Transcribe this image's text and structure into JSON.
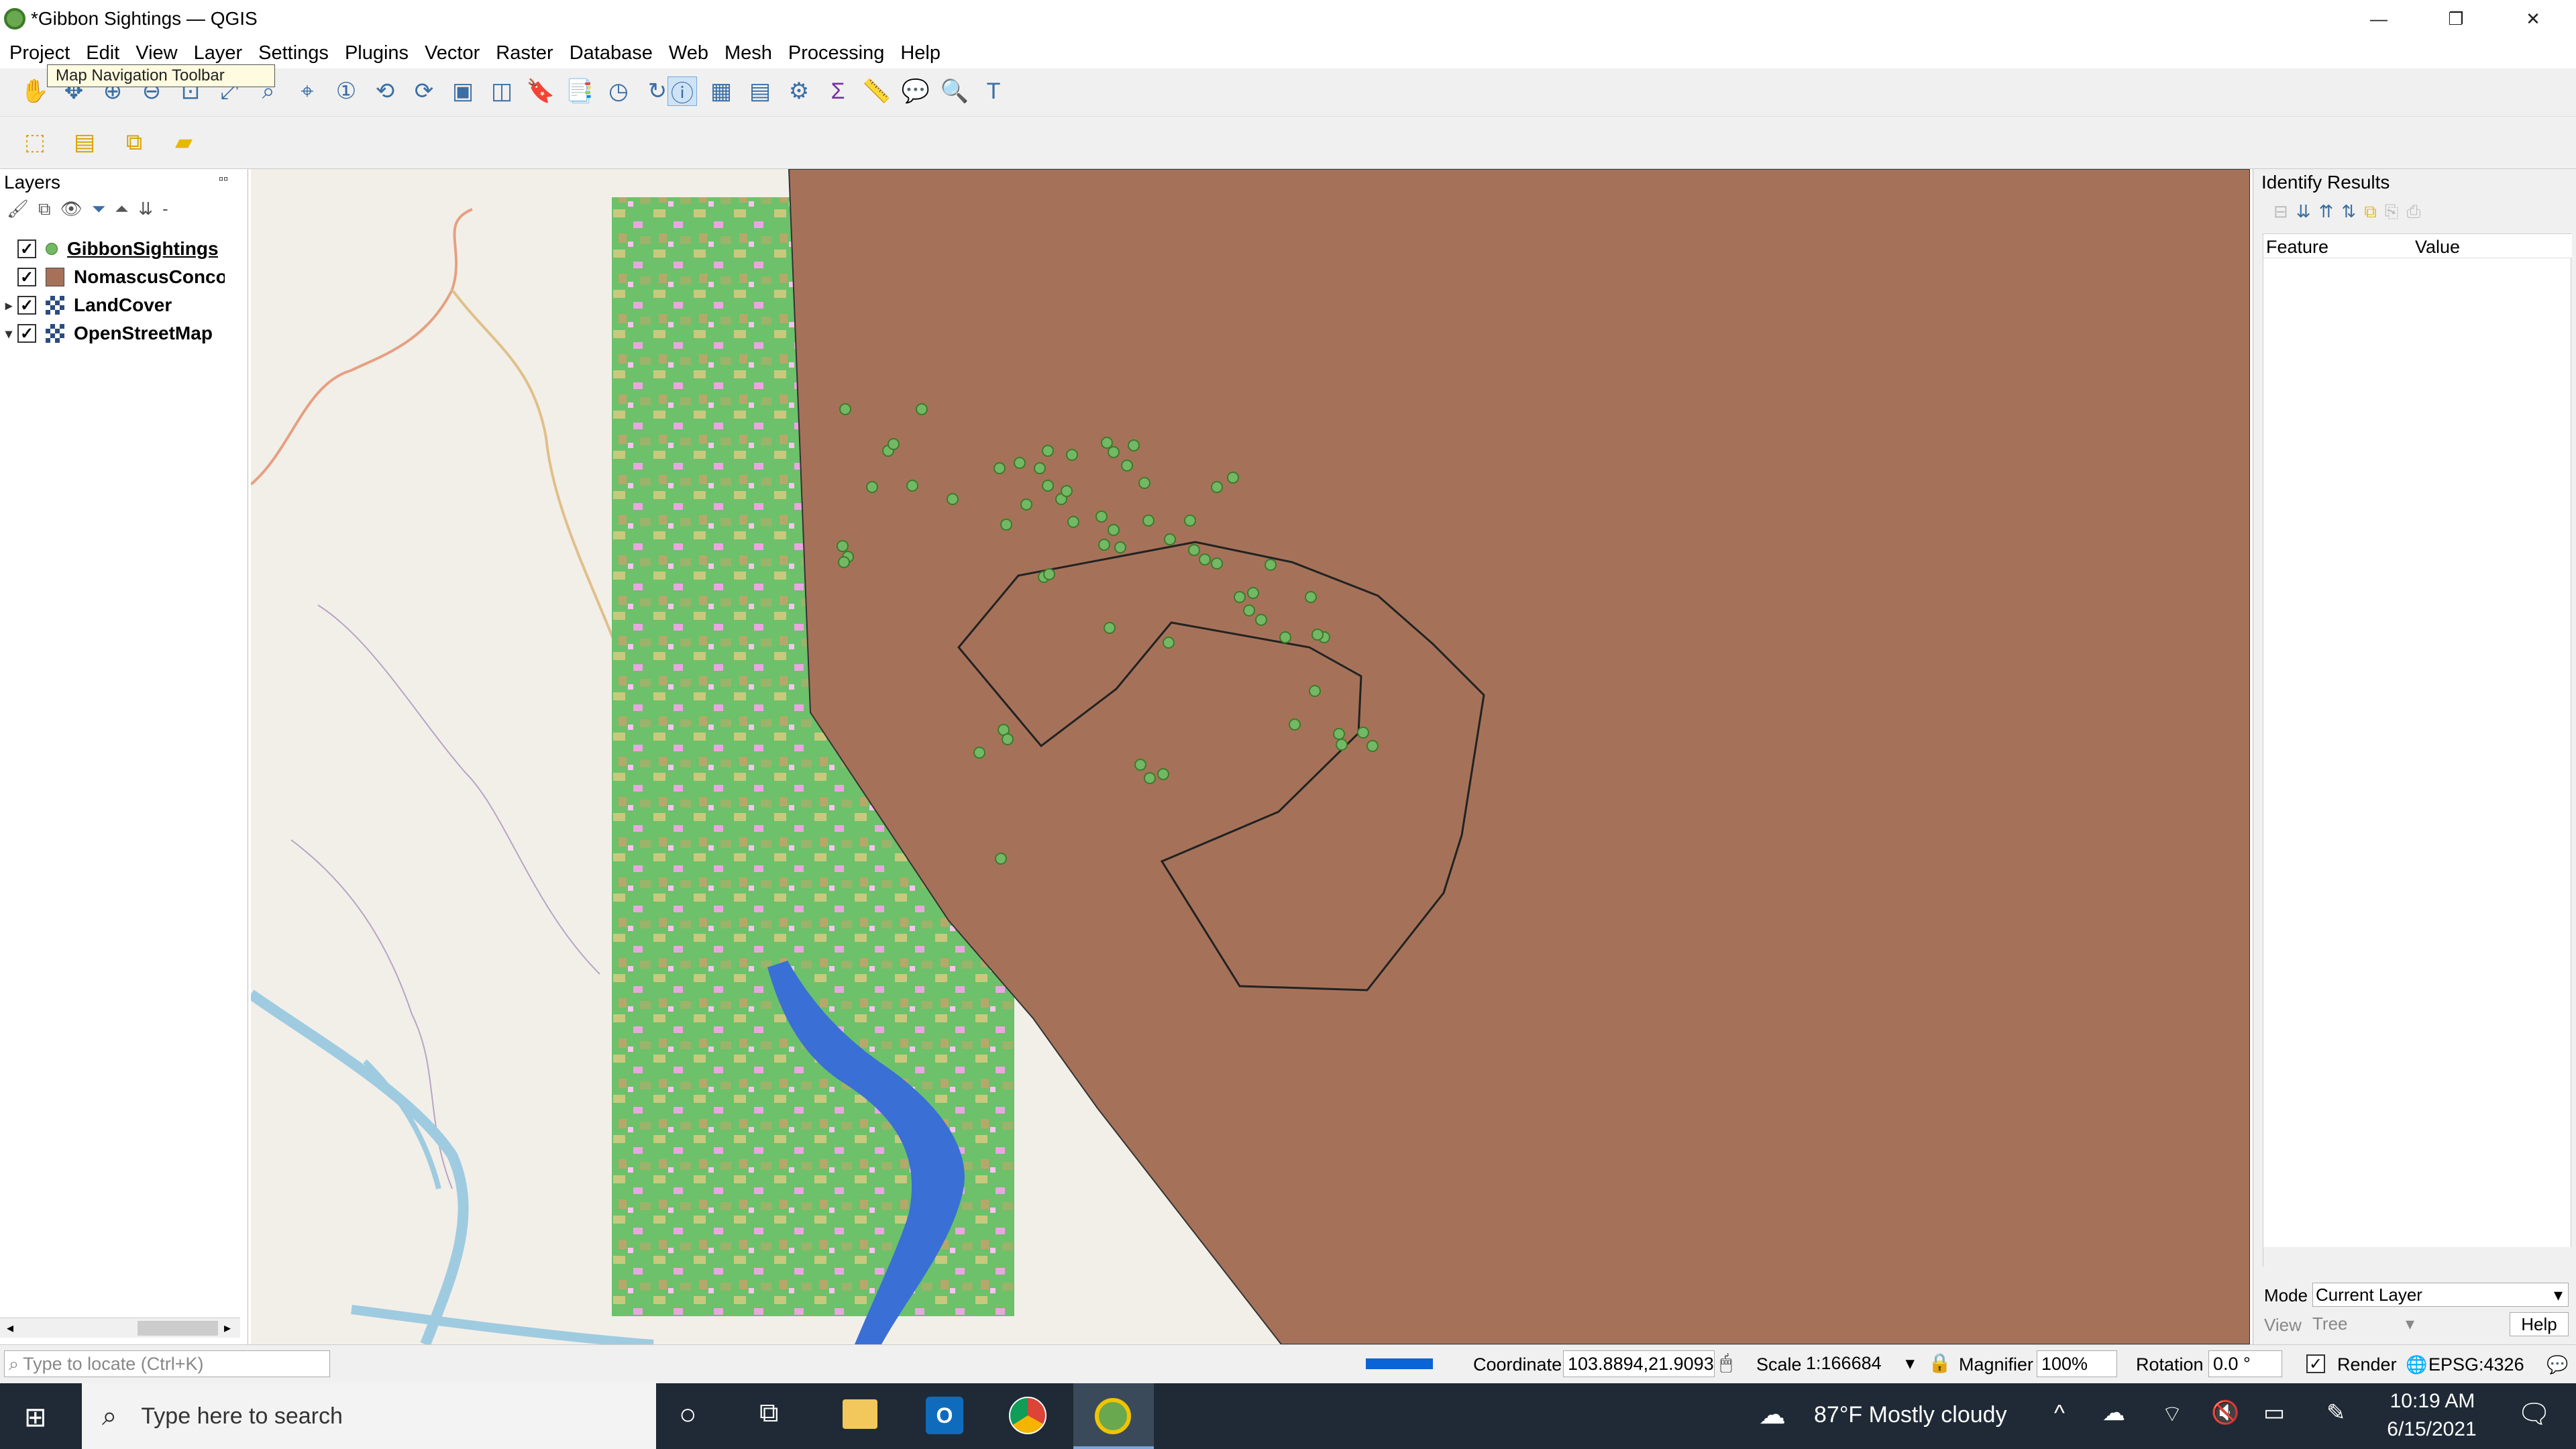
{
  "window": {
    "title": "*Gibbon Sightings — QGIS",
    "minimize": "—",
    "restore": "❐",
    "close": "✕"
  },
  "menu": [
    "Project",
    "Edit",
    "View",
    "Layer",
    "Settings",
    "Plugins",
    "Vector",
    "Raster",
    "Database",
    "Web",
    "Mesh",
    "Processing",
    "Help"
  ],
  "tooltip": "Map Navigation Toolbar",
  "layers_panel": {
    "title": "Layers",
    "layers": [
      {
        "name": "GibbonSightings",
        "checked": true
      },
      {
        "name": "NomascusConcolor",
        "checked": true
      },
      {
        "name": "LandCover",
        "checked": true
      },
      {
        "name": "OpenStreetMap",
        "checked": true
      }
    ]
  },
  "identify": {
    "title": "Identify Results",
    "col_feature": "Feature",
    "col_value": "Value",
    "mode_label": "Mode",
    "mode_value": "Current Layer",
    "view_label": "View",
    "view_value": "Tree",
    "help": "Help"
  },
  "status": {
    "locate_placeholder": "Type to locate (Ctrl+K)",
    "coordinate_label": "Coordinate",
    "coordinate_value": "103.8894,21.9093",
    "scale_label": "Scale",
    "scale_value": "1:166684",
    "magnifier_label": "Magnifier",
    "magnifier_value": "100%",
    "rotation_label": "Rotation",
    "rotation_value": "0.0 °",
    "render_label": "Render",
    "crs": "EPSG:4326"
  },
  "taskbar": {
    "search_placeholder": "Type here to search",
    "weather": "87°F  Mostly cloudy",
    "time": "10:19 AM",
    "date": "6/15/2021"
  },
  "colors": {
    "range": "#a57259",
    "landcover_green": "#6cc16a",
    "water": "#3a6fd6",
    "sightings": "#72b865"
  }
}
